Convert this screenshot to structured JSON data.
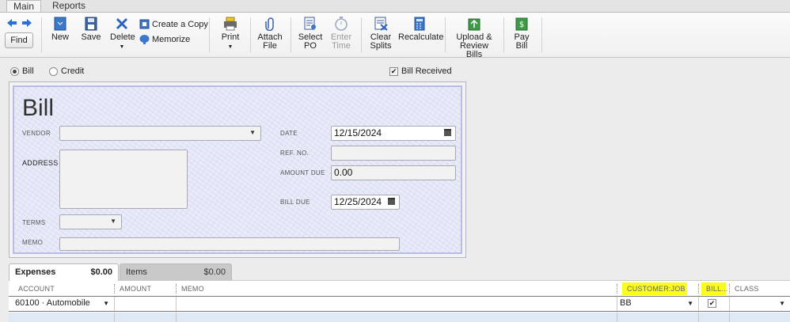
{
  "menu_tabs": [
    "Main",
    "Reports"
  ],
  "toolbar": {
    "find": "Find",
    "new": "New",
    "save": "Save",
    "delete": "Delete",
    "create_copy": "Create a Copy",
    "memorize": "Memorize",
    "print": "Print",
    "attach_file": [
      "Attach",
      "File"
    ],
    "select_po": [
      "Select",
      "PO"
    ],
    "enter_time": [
      "Enter",
      "Time"
    ],
    "clear_splits": [
      "Clear",
      "Splits"
    ],
    "recalculate": "Recalculate",
    "upload_review": [
      "Upload &",
      "Review Bills"
    ],
    "pay_bill": [
      "Pay",
      "Bill"
    ]
  },
  "mode": {
    "bill": "Bill",
    "credit": "Credit",
    "selected": "Bill",
    "bill_received": "Bill Received",
    "bill_received_checked": true
  },
  "form": {
    "title": "Bill",
    "vendor_label": "VENDOR",
    "vendor_value": "",
    "address_label": "ADDRESS",
    "terms_label": "TERMS",
    "memo_label": "MEMO",
    "date_label": "DATE",
    "date_value": "12/15/2024",
    "ref_label": "REF. NO.",
    "ref_value": "",
    "amount_due_label": "AMOUNT DUE",
    "amount_due_value": "0.00",
    "bill_due_label": "BILL DUE",
    "bill_due_value": "12/25/2024"
  },
  "tabs": {
    "expenses_label": "Expenses",
    "expenses_amount": "$0.00",
    "items_label": "Items",
    "items_amount": "$0.00"
  },
  "grid": {
    "columns": [
      "ACCOUNT",
      "AMOUNT",
      "MEMO",
      "CUSTOMER:JOB",
      "BILL...",
      "CLASS"
    ],
    "rows": [
      {
        "account": "60100 · Automobile",
        "amount": "",
        "memo": "",
        "customer_job": "BB",
        "billable": true,
        "class": ""
      }
    ]
  },
  "colors": {
    "highlight": "#fafc1f",
    "form_border": "#b9bde6",
    "row_blue": "#dfe9f6"
  }
}
